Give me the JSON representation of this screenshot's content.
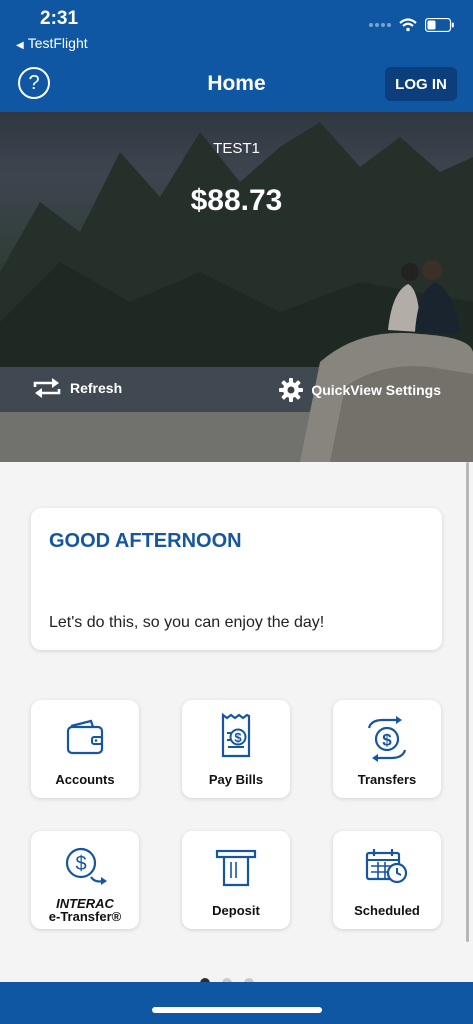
{
  "status": {
    "time": "2:31",
    "back_app": "TestFlight"
  },
  "header": {
    "title": "Home",
    "help_icon": "?",
    "login_label": "LOG IN"
  },
  "hero": {
    "account_name": "TEST1",
    "balance": "$88.73",
    "refresh_label": "Refresh",
    "quickview_label": "QuickView Settings"
  },
  "greeting": {
    "title": "GOOD AFTERNOON",
    "message": "Let's do this, so you can enjoy the day!"
  },
  "tiles": [
    {
      "label": "Accounts",
      "icon": "wallet-icon"
    },
    {
      "label": "Pay Bills",
      "icon": "bill-icon"
    },
    {
      "label": "Transfers",
      "icon": "transfer-icon"
    },
    {
      "label_1": "INTERAC",
      "label_2": "e-Transfer®",
      "icon": "etransfer-icon"
    },
    {
      "label": "Deposit",
      "icon": "deposit-icon"
    },
    {
      "label": "Scheduled",
      "icon": "calendar-clock-icon"
    }
  ],
  "colors": {
    "brand_blue": "#0f57a3",
    "accent_text": "#1656a0",
    "login_button": "#0b3e7a"
  }
}
